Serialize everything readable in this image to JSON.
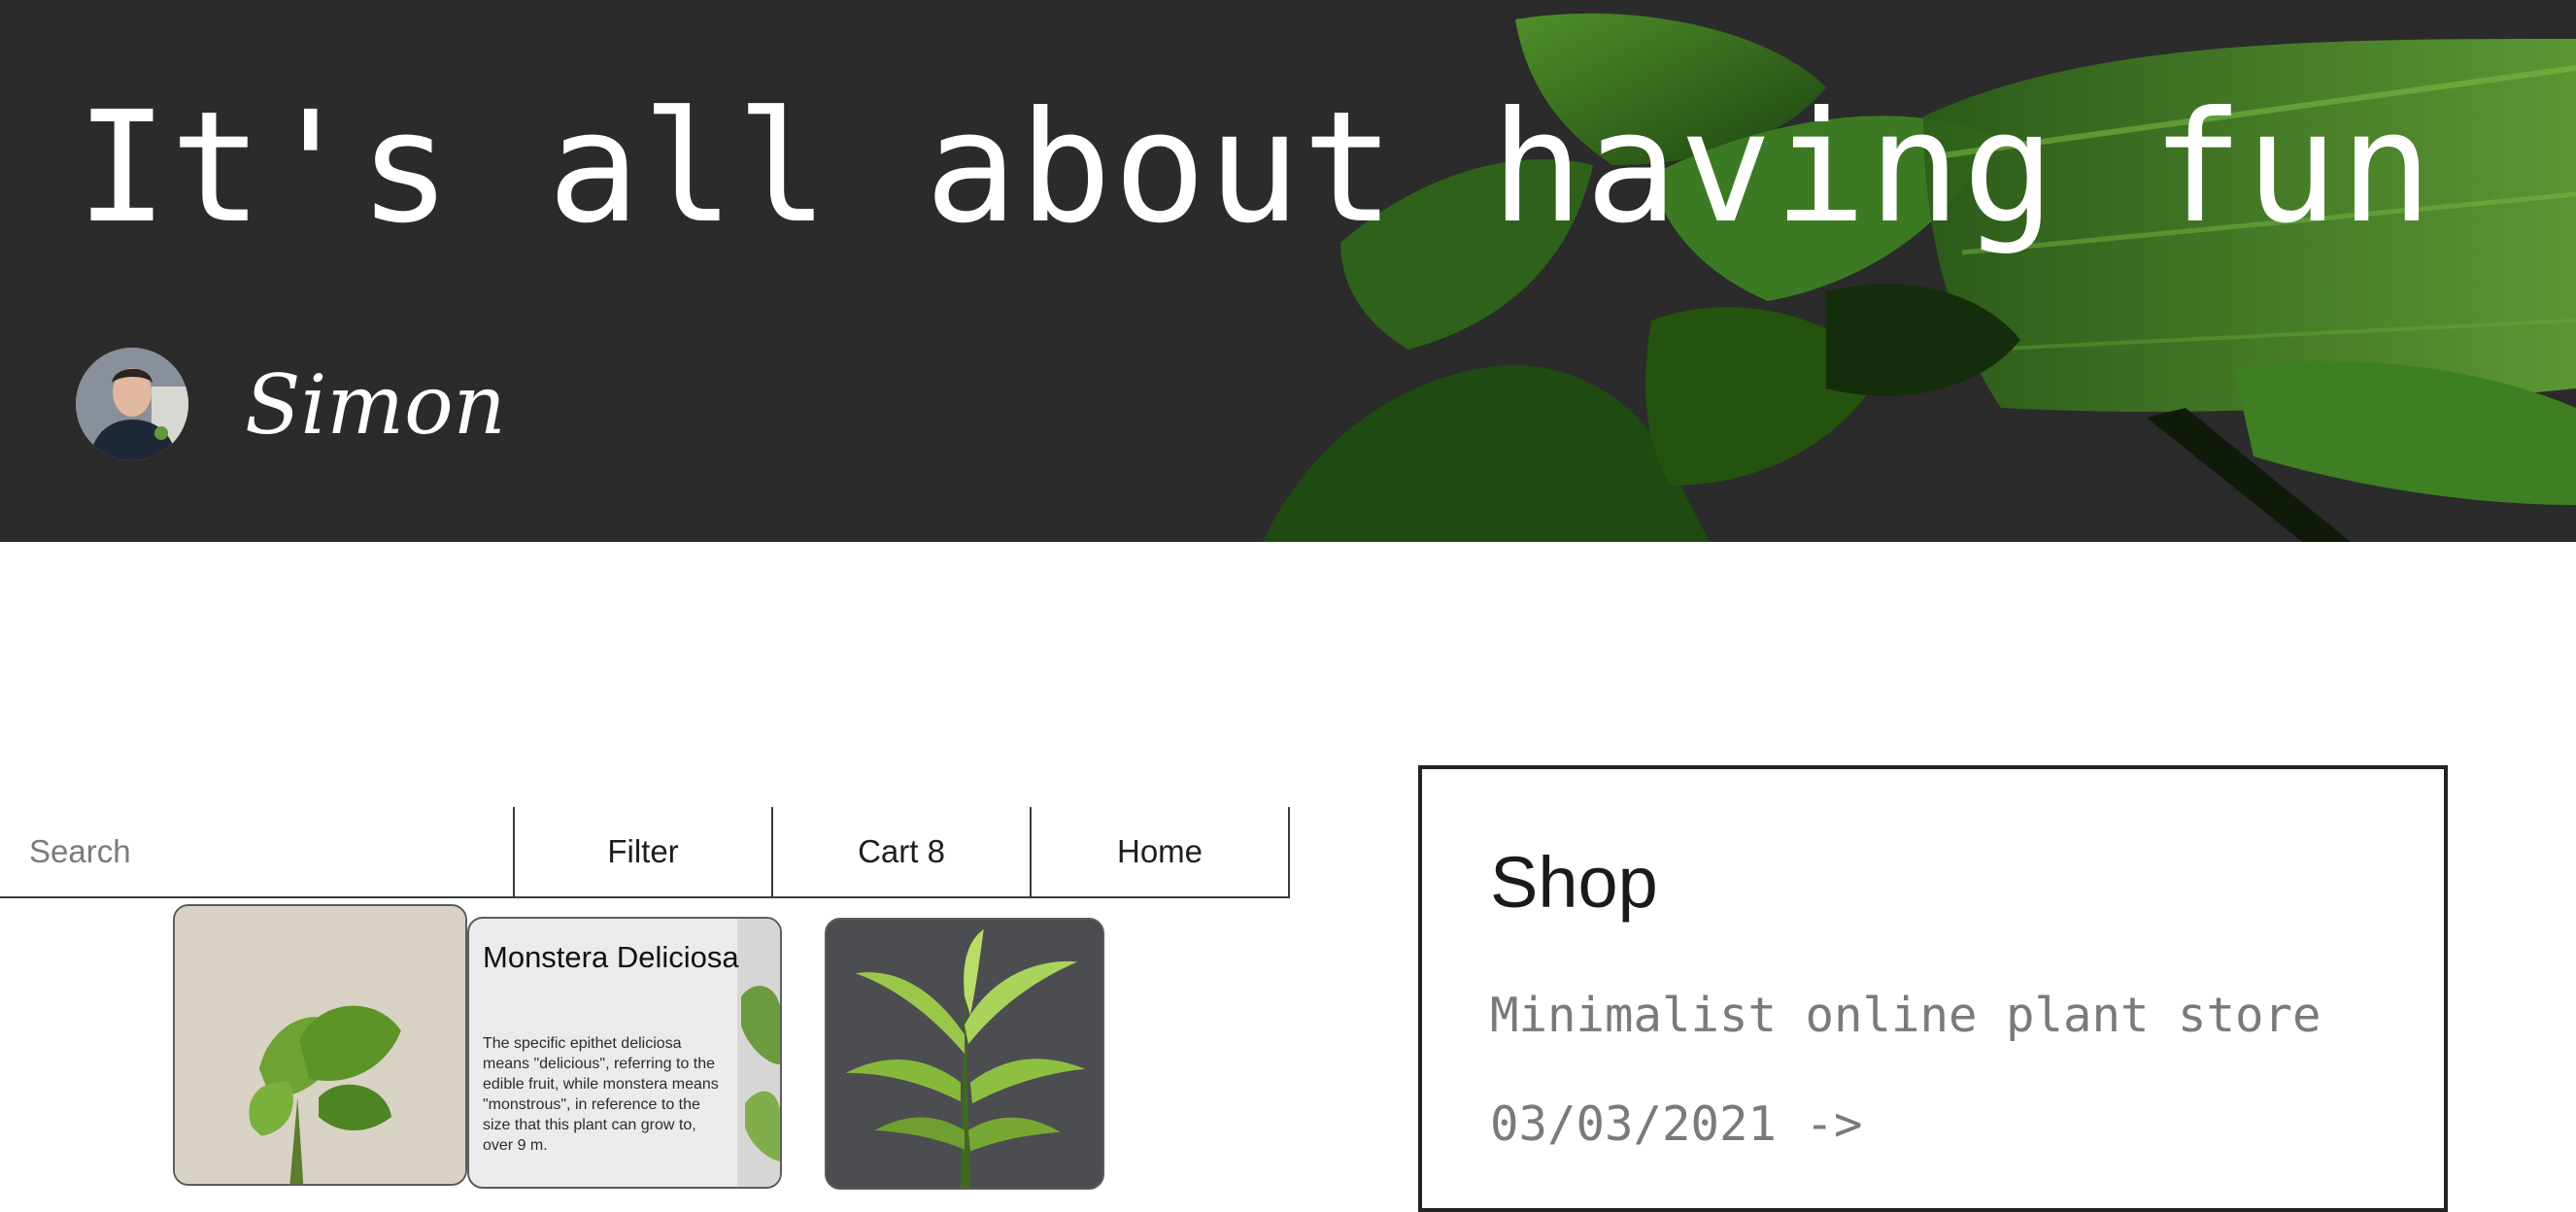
{
  "hero": {
    "title": "It's all about having fun",
    "author_name": "Simon",
    "background_color": "#2b2b2b",
    "leaf_color": "#2f6a1c"
  },
  "toolbar": {
    "search_placeholder": "Search",
    "filter_label": "Filter",
    "cart_label": "Cart 8",
    "home_label": "Home"
  },
  "products": [
    {
      "name": "Monstera Deliciosa",
      "description": "The specific epithet deliciosa means \"delicious\", referring to the edible fruit, while monstera means \"monstrous\", in reference to the size that this plant can grow to, over 9 m."
    }
  ],
  "shop": {
    "title": "Shop",
    "subtitle": "Minimalist online plant store",
    "date_link": "03/03/2021 ->"
  }
}
